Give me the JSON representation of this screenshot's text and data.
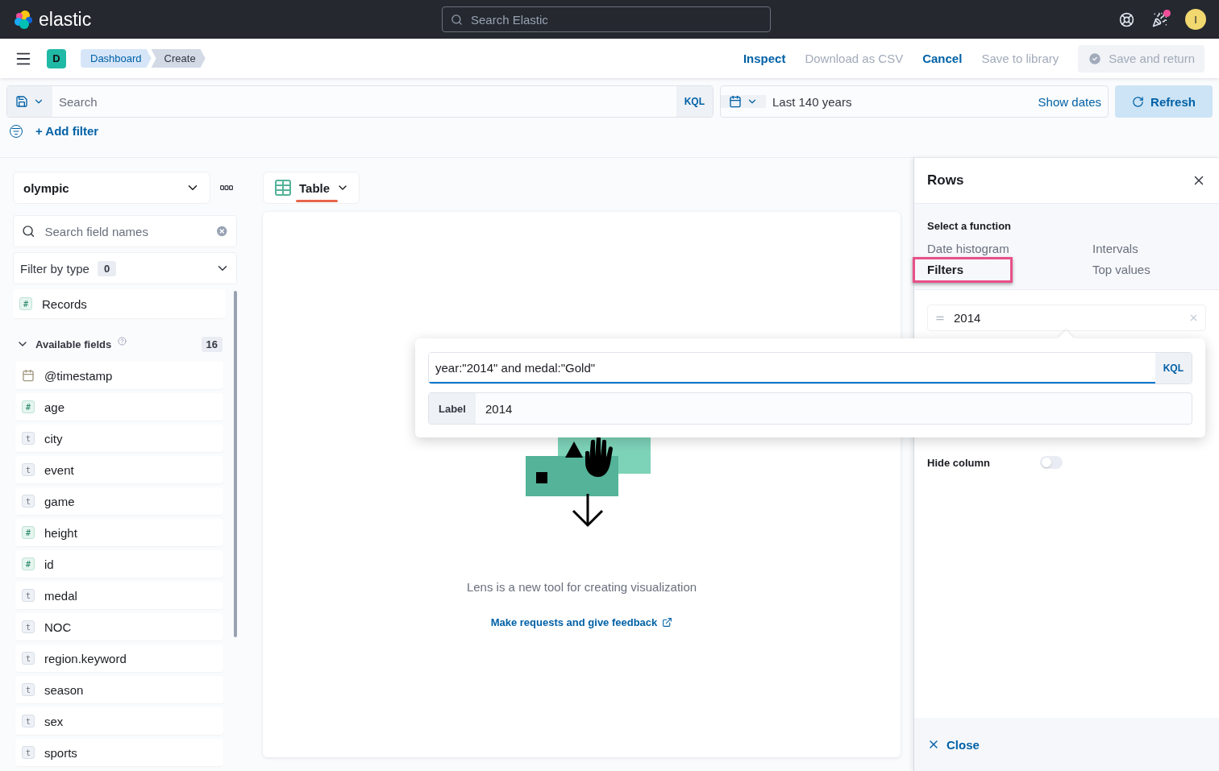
{
  "header": {
    "logo": "elastic",
    "search_placeholder": "Search Elastic",
    "notification": true,
    "avatar": "I"
  },
  "app_bar": {
    "space": "D",
    "breadcrumbs": [
      {
        "label": "Dashboard",
        "selected": false
      },
      {
        "label": "Create",
        "selected": true
      }
    ],
    "actions": [
      {
        "label": "Inspect",
        "disabled": false
      },
      {
        "label": "Download as CSV",
        "disabled": true
      },
      {
        "label": "Cancel",
        "disabled": false
      },
      {
        "label": "Save to library",
        "disabled": true
      }
    ],
    "primary_action": {
      "label": "Save and return",
      "disabled": true
    }
  },
  "query_bar": {
    "placeholder": "Search",
    "language": "KQL",
    "time_range": "Last 140 years",
    "show_dates": "Show dates",
    "refresh": "Refresh",
    "add_filter": "+ Add filter"
  },
  "sidebar": {
    "index_pattern": "olympic",
    "search_placeholder": "Search field names",
    "filter_label": "Filter by type",
    "filter_count": "0",
    "records": {
      "name": "Records",
      "kind": "number",
      "token": "#"
    },
    "section": {
      "title": "Available fields",
      "count": "16",
      "expanded": true
    },
    "fields": [
      {
        "name": "@timestamp",
        "kind": "date"
      },
      {
        "name": "age",
        "kind": "number",
        "token": "#"
      },
      {
        "name": "city",
        "kind": "string",
        "token": "t"
      },
      {
        "name": "event",
        "kind": "string",
        "token": "t"
      },
      {
        "name": "game",
        "kind": "string",
        "token": "t"
      },
      {
        "name": "height",
        "kind": "number",
        "token": "#"
      },
      {
        "name": "id",
        "kind": "number",
        "token": "#"
      },
      {
        "name": "medal",
        "kind": "string",
        "token": "t"
      },
      {
        "name": "NOC",
        "kind": "string",
        "token": "t"
      },
      {
        "name": "region.keyword",
        "kind": "string",
        "token": "t"
      },
      {
        "name": "season",
        "kind": "string",
        "token": "t"
      },
      {
        "name": "sex",
        "kind": "string",
        "token": "t"
      },
      {
        "name": "sports",
        "kind": "string",
        "token": "t"
      }
    ]
  },
  "workspace": {
    "chart_type": {
      "label": "Table",
      "selected": true
    },
    "message": "Lens is a new tool for creating visualization",
    "link": "Make requests and give feedback"
  },
  "flyout": {
    "title": "Rows",
    "function_label": "Select a function",
    "functions": [
      {
        "label": "Date histogram",
        "selected": false
      },
      {
        "label": "Intervals",
        "selected": false
      },
      {
        "label": "Filters",
        "selected": true
      },
      {
        "label": "Top values",
        "selected": false
      }
    ],
    "filters": [
      {
        "label": "2014"
      }
    ],
    "hide_column": {
      "label": "Hide column",
      "on": false
    },
    "close": "Close"
  },
  "popover": {
    "query": "year:\"2014\" and medal:\"Gold\"",
    "language": "KQL",
    "label_prefix": "Label",
    "label_value": "2014"
  }
}
